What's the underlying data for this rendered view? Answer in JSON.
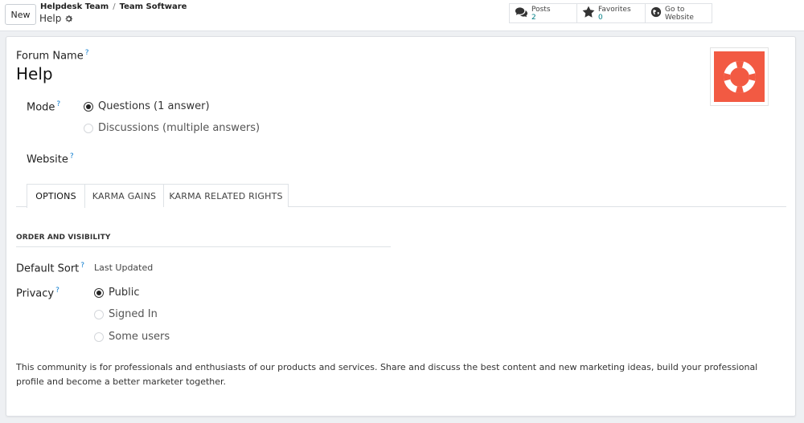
{
  "control_panel": {
    "new_label": "New",
    "breadcrumb": [
      "Helpdesk Team",
      "Team Software"
    ],
    "breadcrumb_separator": "/",
    "record_name": "Help",
    "smart_buttons": [
      {
        "icon": "comments-icon",
        "label": "Posts",
        "value": "2"
      },
      {
        "icon": "star-icon",
        "label": "Favorites",
        "value": "0"
      },
      {
        "icon": "globe-icon",
        "label": "Go to",
        "label2": "Website"
      }
    ]
  },
  "form": {
    "forum_name_label": "Forum Name",
    "help_mark": "?",
    "forum_name": "Help",
    "image_icon": "life-ring-icon",
    "mode_label": "Mode",
    "mode_options": [
      {
        "label": "Questions (1 answer)",
        "selected": true
      },
      {
        "label": "Discussions (multiple answers)",
        "selected": false
      }
    ],
    "website_label": "Website",
    "tabs": [
      "OPTIONS",
      "KARMA GAINS",
      "KARMA RELATED RIGHTS"
    ],
    "active_tab": "OPTIONS",
    "section_title": "ORDER AND VISIBILITY",
    "default_sort_label": "Default Sort",
    "default_sort_value": "Last Updated",
    "privacy_label": "Privacy",
    "privacy_options": [
      {
        "label": "Public",
        "selected": true
      },
      {
        "label": "Signed In",
        "selected": false
      },
      {
        "label": "Some users",
        "selected": false
      }
    ],
    "description": "This community is for professionals and enthusiasts of our products and services. Share and discuss the best content and new marketing ideas, build your professional profile and become a better marketer together."
  },
  "colors": {
    "accent": "#017e84",
    "help_mark": "#0b7bce",
    "image_bg": "#f25a43"
  }
}
